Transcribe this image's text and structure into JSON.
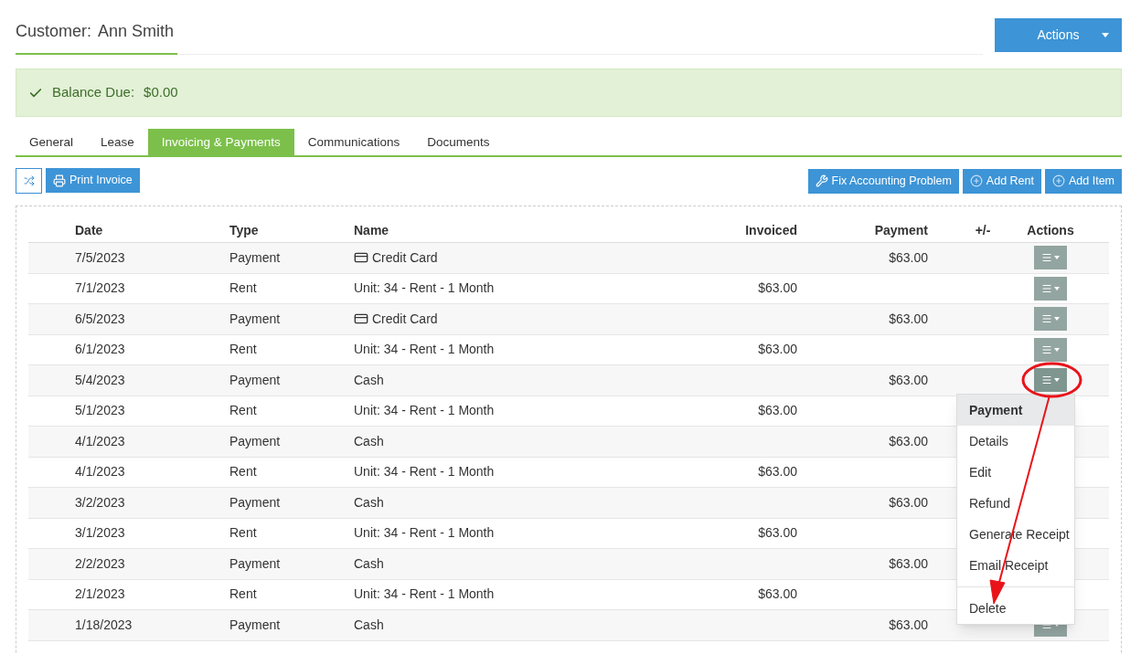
{
  "header": {
    "label": "Customer:",
    "name": "Ann Smith",
    "actions_button": "Actions"
  },
  "alert": {
    "label": "Balance Due:",
    "value": "$0.00"
  },
  "tabs": [
    {
      "label": "General",
      "selected": false
    },
    {
      "label": "Lease",
      "selected": false
    },
    {
      "label": "Invoicing & Payments",
      "selected": true
    },
    {
      "label": "Communications",
      "selected": false
    },
    {
      "label": "Documents",
      "selected": false
    }
  ],
  "toolbar": {
    "left": [
      {
        "kind": "shuffle"
      },
      {
        "kind": "print",
        "label": "Print Invoice"
      }
    ],
    "right": [
      {
        "kind": "tools",
        "label": "Fix Accounting Problem"
      },
      {
        "kind": "add",
        "label": "Add Rent"
      },
      {
        "kind": "add",
        "label": "Add Item"
      }
    ]
  },
  "table": {
    "columns": [
      "Date",
      "Type",
      "Name",
      "Invoiced",
      "Payment",
      "+/-",
      "Actions"
    ],
    "rows": [
      {
        "date": "7/5/2023",
        "type": "Payment",
        "name": "Credit Card",
        "card_icon": true,
        "invoiced": "",
        "payment": "$63.00",
        "menu_open": false
      },
      {
        "date": "7/1/2023",
        "type": "Rent",
        "name": "Unit: 34 - Rent - 1 Month",
        "invoiced": "$63.00",
        "payment": "",
        "menu_open": false
      },
      {
        "date": "6/5/2023",
        "type": "Payment",
        "name": "Credit Card",
        "card_icon": true,
        "invoiced": "",
        "payment": "$63.00",
        "menu_open": false
      },
      {
        "date": "6/1/2023",
        "type": "Rent",
        "name": "Unit: 34 - Rent - 1 Month",
        "invoiced": "$63.00",
        "payment": "",
        "menu_open": false
      },
      {
        "date": "5/4/2023",
        "type": "Payment",
        "name": "Cash",
        "invoiced": "",
        "payment": "$63.00",
        "menu_open": true
      },
      {
        "date": "5/1/2023",
        "type": "Rent",
        "name": "Unit: 34 - Rent - 1 Month",
        "invoiced": "$63.00",
        "payment": "",
        "menu_open": false
      },
      {
        "date": "4/1/2023",
        "type": "Payment",
        "name": "Cash",
        "invoiced": "",
        "payment": "$63.00",
        "menu_open": false
      },
      {
        "date": "4/1/2023",
        "type": "Rent",
        "name": "Unit: 34 - Rent - 1 Month",
        "invoiced": "$63.00",
        "payment": "",
        "menu_open": false
      },
      {
        "date": "3/2/2023",
        "type": "Payment",
        "name": "Cash",
        "invoiced": "",
        "payment": "$63.00",
        "menu_open": false
      },
      {
        "date": "3/1/2023",
        "type": "Rent",
        "name": "Unit: 34 - Rent - 1 Month",
        "invoiced": "$63.00",
        "payment": "",
        "menu_open": false
      },
      {
        "date": "2/2/2023",
        "type": "Payment",
        "name": "Cash",
        "invoiced": "",
        "payment": "$63.00",
        "menu_open": false
      },
      {
        "date": "2/1/2023",
        "type": "Rent",
        "name": "Unit: 34 - Rent - 1 Month",
        "invoiced": "$63.00",
        "payment": "",
        "menu_open": false
      },
      {
        "date": "1/18/2023",
        "type": "Payment",
        "name": "Cash",
        "invoiced": "",
        "payment": "$63.00",
        "menu_open": false
      }
    ]
  },
  "row_menu": {
    "title": "Payment",
    "items": [
      {
        "label": "Details",
        "separator_before": false
      },
      {
        "label": "Edit",
        "separator_before": false
      },
      {
        "label": "Refund",
        "separator_before": false
      },
      {
        "label": "Generate Receipt",
        "separator_before": false
      },
      {
        "label": "Email Receipt",
        "separator_before": false
      },
      {
        "label": "Delete",
        "separator_before": true
      }
    ]
  }
}
